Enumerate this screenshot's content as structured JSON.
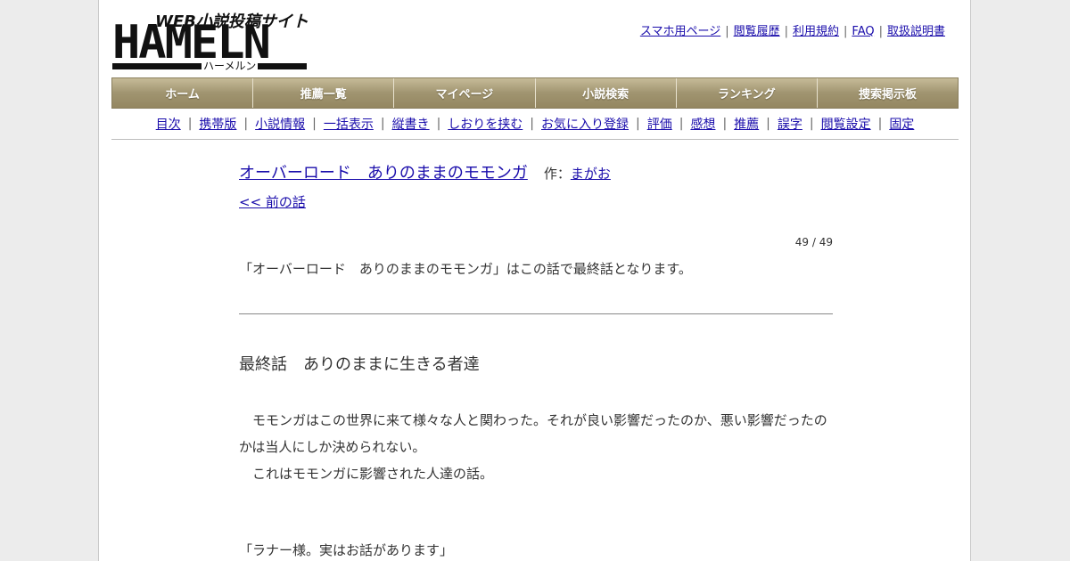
{
  "logo": {
    "tagline": "WEB小説投稿サイト",
    "wordmark": "HAMELN",
    "kana": "ハーメルン"
  },
  "toplinks": [
    "スマホ用ページ",
    "閲覧履歴",
    "利用規約",
    "FAQ",
    "取扱説明書"
  ],
  "mainnav": [
    "ホーム",
    "推薦一覧",
    "マイページ",
    "小説検索",
    "ランキング",
    "捜索掲示板"
  ],
  "subnav": [
    "目次",
    "携帯版",
    "小説情報",
    "一括表示",
    "縦書き",
    "しおりを挟む",
    "お気に入り登録",
    "評価",
    "感想",
    "推薦",
    "誤字",
    "閲覧設定",
    "固定"
  ],
  "novel": {
    "title": "オーバーロード　ありのままのモモンガ",
    "author_prefix": "作：",
    "author": "まがお",
    "prev_link": "<< 前の話",
    "counter": "49 / 49",
    "notice": "「オーバーロード　ありのままのモモンガ」はこの話で最終話となります。"
  },
  "chapter": {
    "title": "最終話　ありのままに生きる者達",
    "paragraphs": [
      "　モモンガはこの世界に来て様々な人と関わった。それが良い影響だったのか、悪い影響だったのかは当人にしか決められない。",
      "　これはモモンガに影響された人達の話。"
    ],
    "dialogue": "「ラナー様。実はお話があります」"
  }
}
